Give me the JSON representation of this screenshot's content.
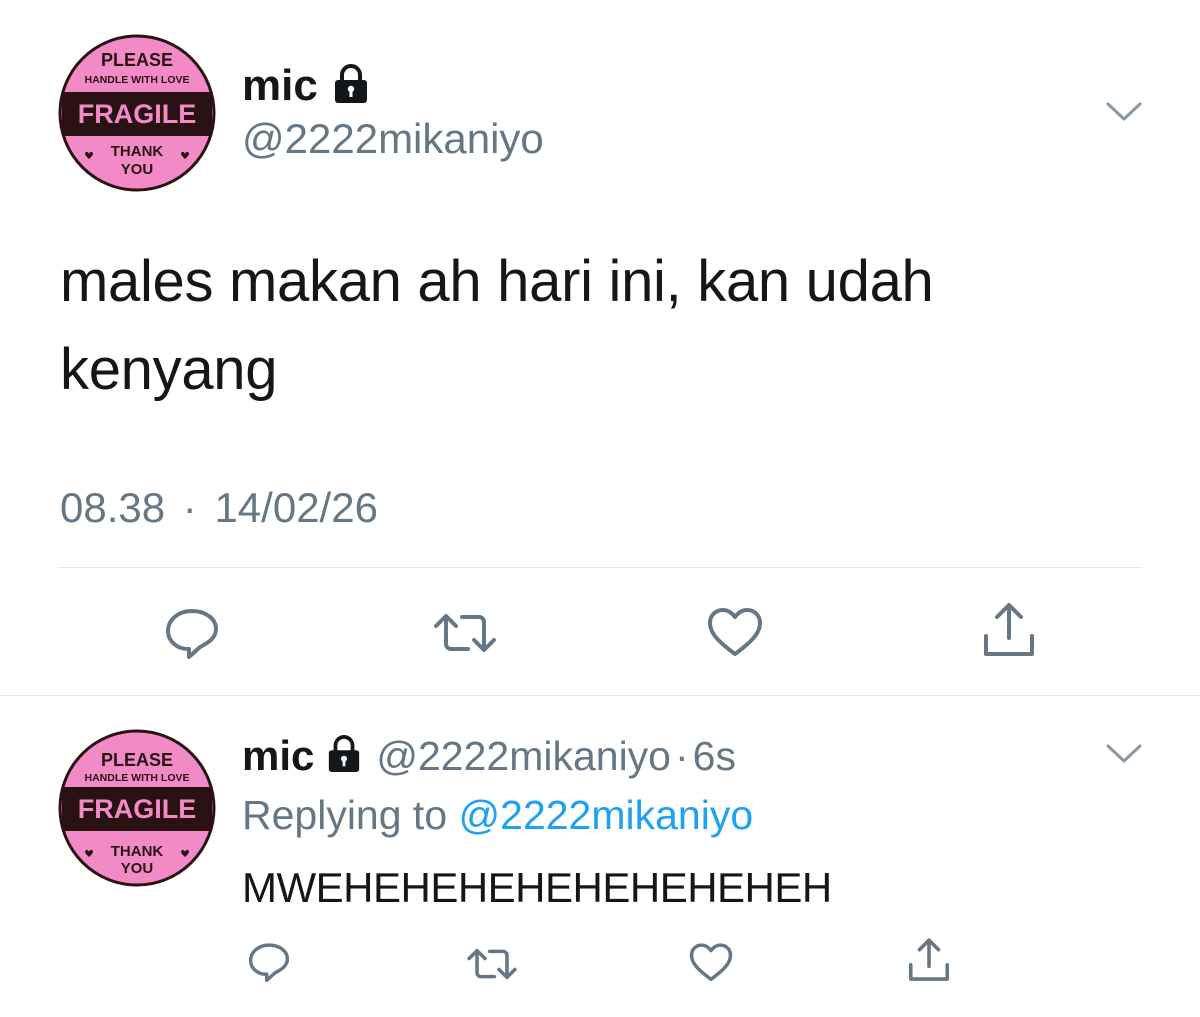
{
  "main_tweet": {
    "author": {
      "name": "mic",
      "handle": "@2222mikaniyo",
      "protected_icon": "lock-icon"
    },
    "avatar": {
      "line1": "PLEASE",
      "line2": "HANDLE WITH LOVE",
      "line3": "FRAGILE",
      "line4": "THANK",
      "line5": "YOU",
      "colors": {
        "pink": "#f28ac6",
        "dark": "#2a1114"
      }
    },
    "text_line1": "males makan ah hari ini, kan udah",
    "text_line2": "kenyang",
    "time": "08.38",
    "separator": "·",
    "date": "14/02/26",
    "actions": [
      "reply-icon",
      "retweet-icon",
      "like-icon",
      "share-icon"
    ],
    "menu_icon": "chevron-down-icon"
  },
  "reply_tweet": {
    "author": {
      "name": "mic",
      "handle": "@2222mikaniyo",
      "protected_icon": "lock-icon"
    },
    "time_separator": "·",
    "relative_time": "6s",
    "replying_prefix": "Replying to",
    "replying_to": "@2222mikaniyo",
    "text": "MWEHEHEHEHEHEHEHEHEH",
    "actions": [
      "reply-icon",
      "retweet-icon",
      "like-icon",
      "share-icon"
    ],
    "menu_icon": "chevron-down-icon"
  },
  "colors": {
    "text": "#14171a",
    "secondary": "#657786",
    "link": "#1da1f2",
    "divider": "#e1e8ed",
    "icon": "#657786"
  }
}
